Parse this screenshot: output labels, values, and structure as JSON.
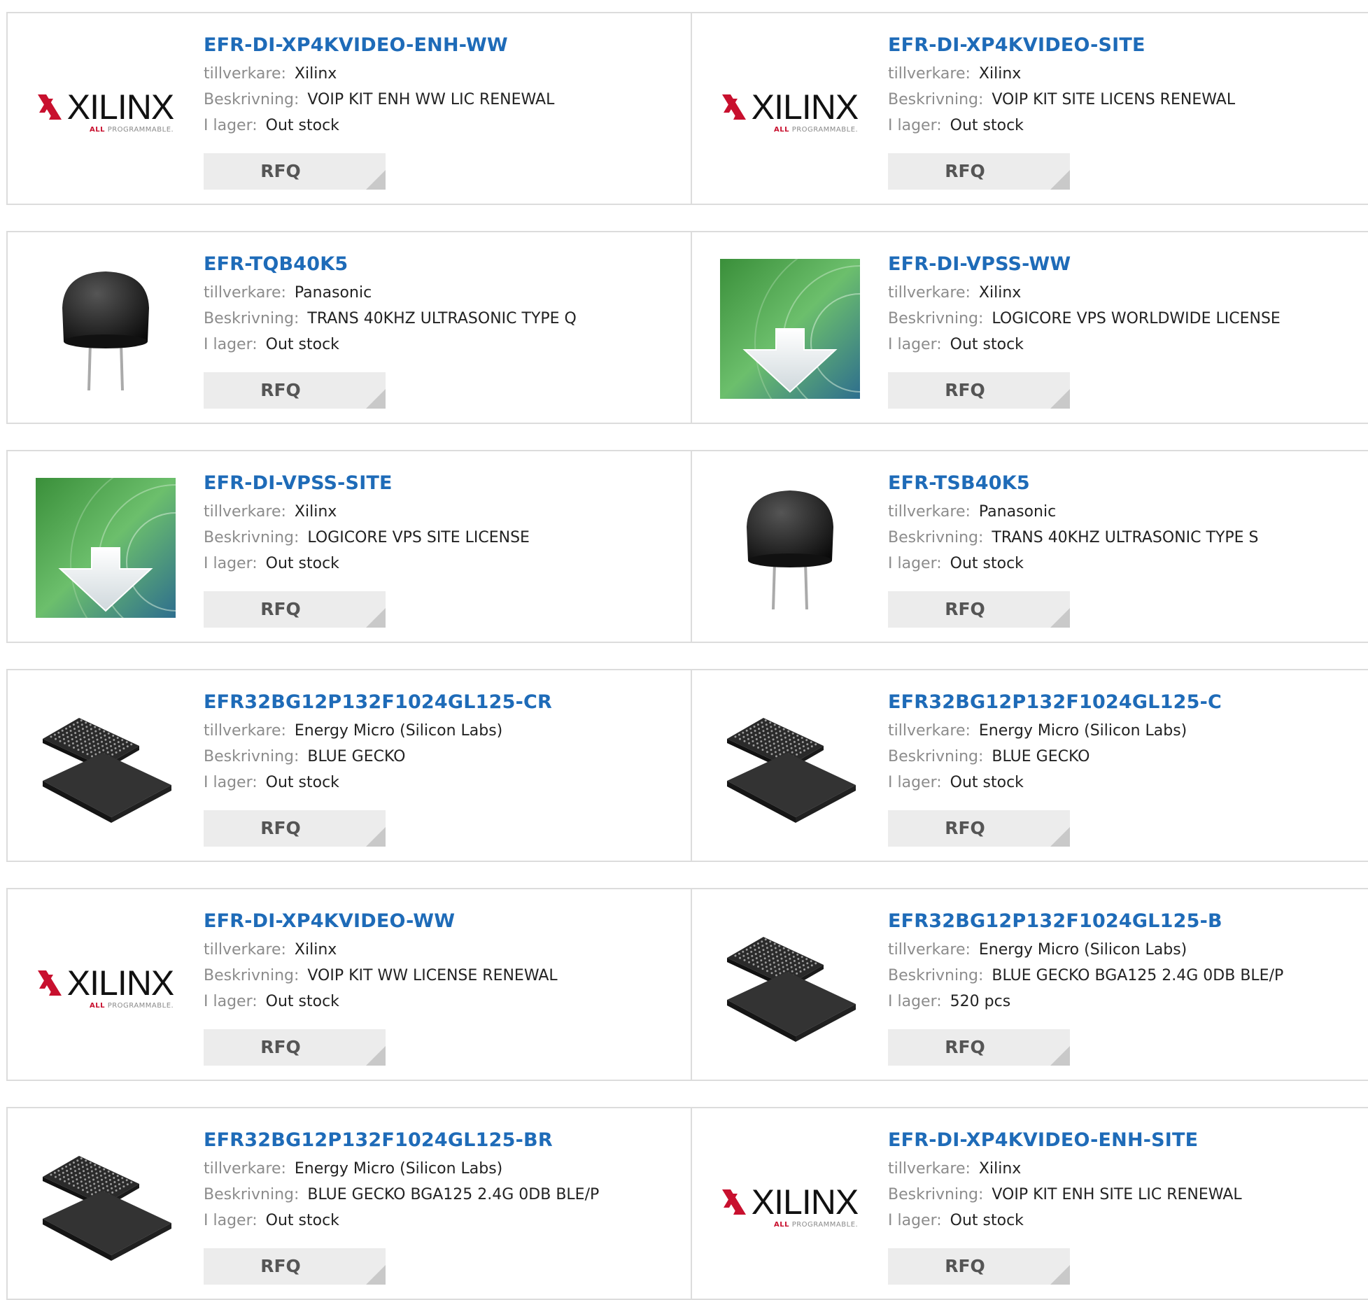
{
  "labels": {
    "manufacturer": "tillverkare:",
    "description": "Beskrivning:",
    "stock": "I lager:",
    "rfq": "RFQ"
  },
  "logo": {
    "xilinx_word": "XILINX",
    "xilinx_sub_accent": "ALL",
    "xilinx_sub_rest": " PROGRAMMABLE."
  },
  "colors": {
    "title": "#1e6bb8",
    "label": "#8c8c8c",
    "rfq_bg": "#ececec",
    "xilinx_red": "#c8102e"
  },
  "products": [
    {
      "title": "EFR-DI-XP4KVIDEO-ENH-WW",
      "manufacturer": "Xilinx",
      "description": "VOIP KIT ENH WW LIC RENEWAL",
      "stock": "Out stock",
      "image": "xilinx-logo"
    },
    {
      "title": "EFR-DI-XP4KVIDEO-SITE",
      "manufacturer": "Xilinx",
      "description": "VOIP KIT SITE LICENS RENEWAL",
      "stock": "Out stock",
      "image": "xilinx-logo"
    },
    {
      "title": "EFR-TQB40K5",
      "manufacturer": "Panasonic",
      "description": "TRANS 40KHZ ULTRASONIC TYPE Q",
      "stock": "Out stock",
      "image": "ultrasonic-sensor"
    },
    {
      "title": "EFR-DI-VPSS-WW",
      "manufacturer": "Xilinx",
      "description": "LOGICORE VPS WORLDWIDE LICENSE",
      "stock": "Out stock",
      "image": "download-disc"
    },
    {
      "title": "EFR-DI-VPSS-SITE",
      "manufacturer": "Xilinx",
      "description": "LOGICORE VPS SITE LICENSE",
      "stock": "Out stock",
      "image": "download-disc"
    },
    {
      "title": "EFR-TSB40K5",
      "manufacturer": "Panasonic",
      "description": "TRANS 40KHZ ULTRASONIC TYPE S",
      "stock": "Out stock",
      "image": "ultrasonic-sensor"
    },
    {
      "title": "EFR32BG12P132F1024GL125-CR",
      "manufacturer": "Energy Micro (Silicon Labs)",
      "description": "BLUE GECKO",
      "stock": "Out stock",
      "image": "bga-chip"
    },
    {
      "title": "EFR32BG12P132F1024GL125-C",
      "manufacturer": "Energy Micro (Silicon Labs)",
      "description": "BLUE GECKO",
      "stock": "Out stock",
      "image": "bga-chip"
    },
    {
      "title": "EFR-DI-XP4KVIDEO-WW",
      "manufacturer": "Xilinx",
      "description": "VOIP KIT WW LICENSE RENEWAL",
      "stock": "Out stock",
      "image": "xilinx-logo"
    },
    {
      "title": "EFR32BG12P132F1024GL125-B",
      "manufacturer": "Energy Micro (Silicon Labs)",
      "description": "BLUE GECKO BGA125 2.4G 0DB BLE/P",
      "stock": "520 pcs",
      "image": "bga-chip"
    },
    {
      "title": "EFR32BG12P132F1024GL125-BR",
      "manufacturer": "Energy Micro (Silicon Labs)",
      "description": "BLUE GECKO BGA125 2.4G 0DB BLE/P",
      "stock": "Out stock",
      "image": "bga-chip"
    },
    {
      "title": "EFR-DI-XP4KVIDEO-ENH-SITE",
      "manufacturer": "Xilinx",
      "description": "VOIP KIT ENH SITE LIC RENEWAL",
      "stock": "Out stock",
      "image": "xilinx-logo"
    }
  ]
}
